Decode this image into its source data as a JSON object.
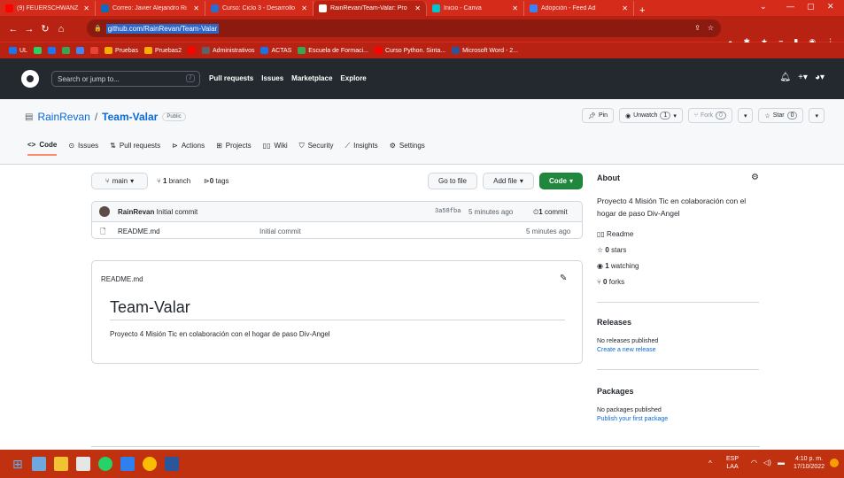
{
  "browser": {
    "tabs": [
      {
        "title": "(9) FEUERSCHWANZ - V",
        "icon": "youtube-icon",
        "active": false,
        "color": "#ff0000"
      },
      {
        "title": "Correo: Javier Alejandro Ri",
        "icon": "outlook-icon",
        "active": false,
        "color": "#0f6cbd"
      },
      {
        "title": "Curso: Ciclo 3 - Desarrollo",
        "icon": "moodle-icon",
        "active": false,
        "color": "#2d6bcf"
      },
      {
        "title": "RainRevan/Team-Valar: Pro",
        "icon": "github-icon",
        "active": true,
        "color": "#ffffff"
      },
      {
        "title": "Inicio - Canva",
        "icon": "canva-icon",
        "active": false,
        "color": "#00c4cc"
      },
      {
        "title": "Adopción - Feed Ad",
        "icon": "feed-icon",
        "active": false,
        "color": "#3b82f6"
      }
    ],
    "new_tab": "+",
    "url": "github.com/RainRevan/Team-Valar",
    "bookmarks": [
      {
        "label": "UL",
        "color": "#1877f2"
      },
      {
        "label": "",
        "color": "#25d366"
      },
      {
        "label": "",
        "color": "#1877f2"
      },
      {
        "label": "",
        "color": "#34a853"
      },
      {
        "label": "",
        "color": "#4285f4"
      },
      {
        "label": "",
        "color": "#ea4335"
      },
      {
        "label": "Pruebas",
        "color": "#f9ab00"
      },
      {
        "label": "Pruebas2",
        "color": "#f9ab00"
      },
      {
        "label": "",
        "color": "#ff0000"
      },
      {
        "label": "Administrativos",
        "color": "#5f6368"
      },
      {
        "label": "ACTAS",
        "color": "#1a73e8"
      },
      {
        "label": "Escuela de Formaci...",
        "color": "#34a853"
      },
      {
        "label": "Curso Python. Sinta...",
        "color": "#ff0000"
      },
      {
        "label": "Microsoft Word - 2...",
        "color": "#2b579a"
      }
    ]
  },
  "github_header": {
    "search_placeholder": "Search or jump to...",
    "slash": "/",
    "nav": [
      "Pull requests",
      "Issues",
      "Marketplace",
      "Explore"
    ]
  },
  "repo": {
    "owner": "RainRevan",
    "separator": "/",
    "name": "Team-Valar",
    "visibility": "Public",
    "pin": "Pin",
    "unwatch": "Unwatch",
    "unwatch_count": "1",
    "fork": "Fork",
    "fork_count": "0",
    "star": "Star",
    "star_count": "0",
    "tabs": [
      "Code",
      "Issues",
      "Pull requests",
      "Actions",
      "Projects",
      "Wiki",
      "Security",
      "Insights",
      "Settings"
    ]
  },
  "code": {
    "branch": "main",
    "branches_count": "1",
    "branches_label": "branch",
    "tags_count": "0",
    "tags_label": "tags",
    "go_to_file": "Go to file",
    "add_file": "Add file",
    "code_button": "Code",
    "commit_author": "RainRevan",
    "commit_message": "Initial commit",
    "commit_hash": "3a58fba",
    "commit_time": "5 minutes ago",
    "commit_count": "1",
    "commit_label": "commit",
    "files": [
      {
        "name": "README.md",
        "message": "Initial commit",
        "time": "5 minutes ago"
      }
    ]
  },
  "readme": {
    "filename": "README.md",
    "heading": "Team-Valar",
    "body": "Proyecto 4 Misión Tic en colaboración con el hogar de paso Div-Angel"
  },
  "about": {
    "title": "About",
    "description": "Proyecto 4 Misión Tic en colaboración con el hogar de paso Div-Angel",
    "readme": "Readme",
    "stars_count": "0",
    "stars_label": "stars",
    "watching_count": "1",
    "watching_label": "watching",
    "forks_count": "0",
    "forks_label": "forks"
  },
  "releases": {
    "title": "Releases",
    "none": "No releases published",
    "create": "Create a new release"
  },
  "packages": {
    "title": "Packages",
    "none": "No packages published",
    "publish": "Publish your first package"
  },
  "taskbar": {
    "lang": "ESP",
    "region": "LAA",
    "time": "4:10 p. m.",
    "date": "17/10/2022"
  }
}
